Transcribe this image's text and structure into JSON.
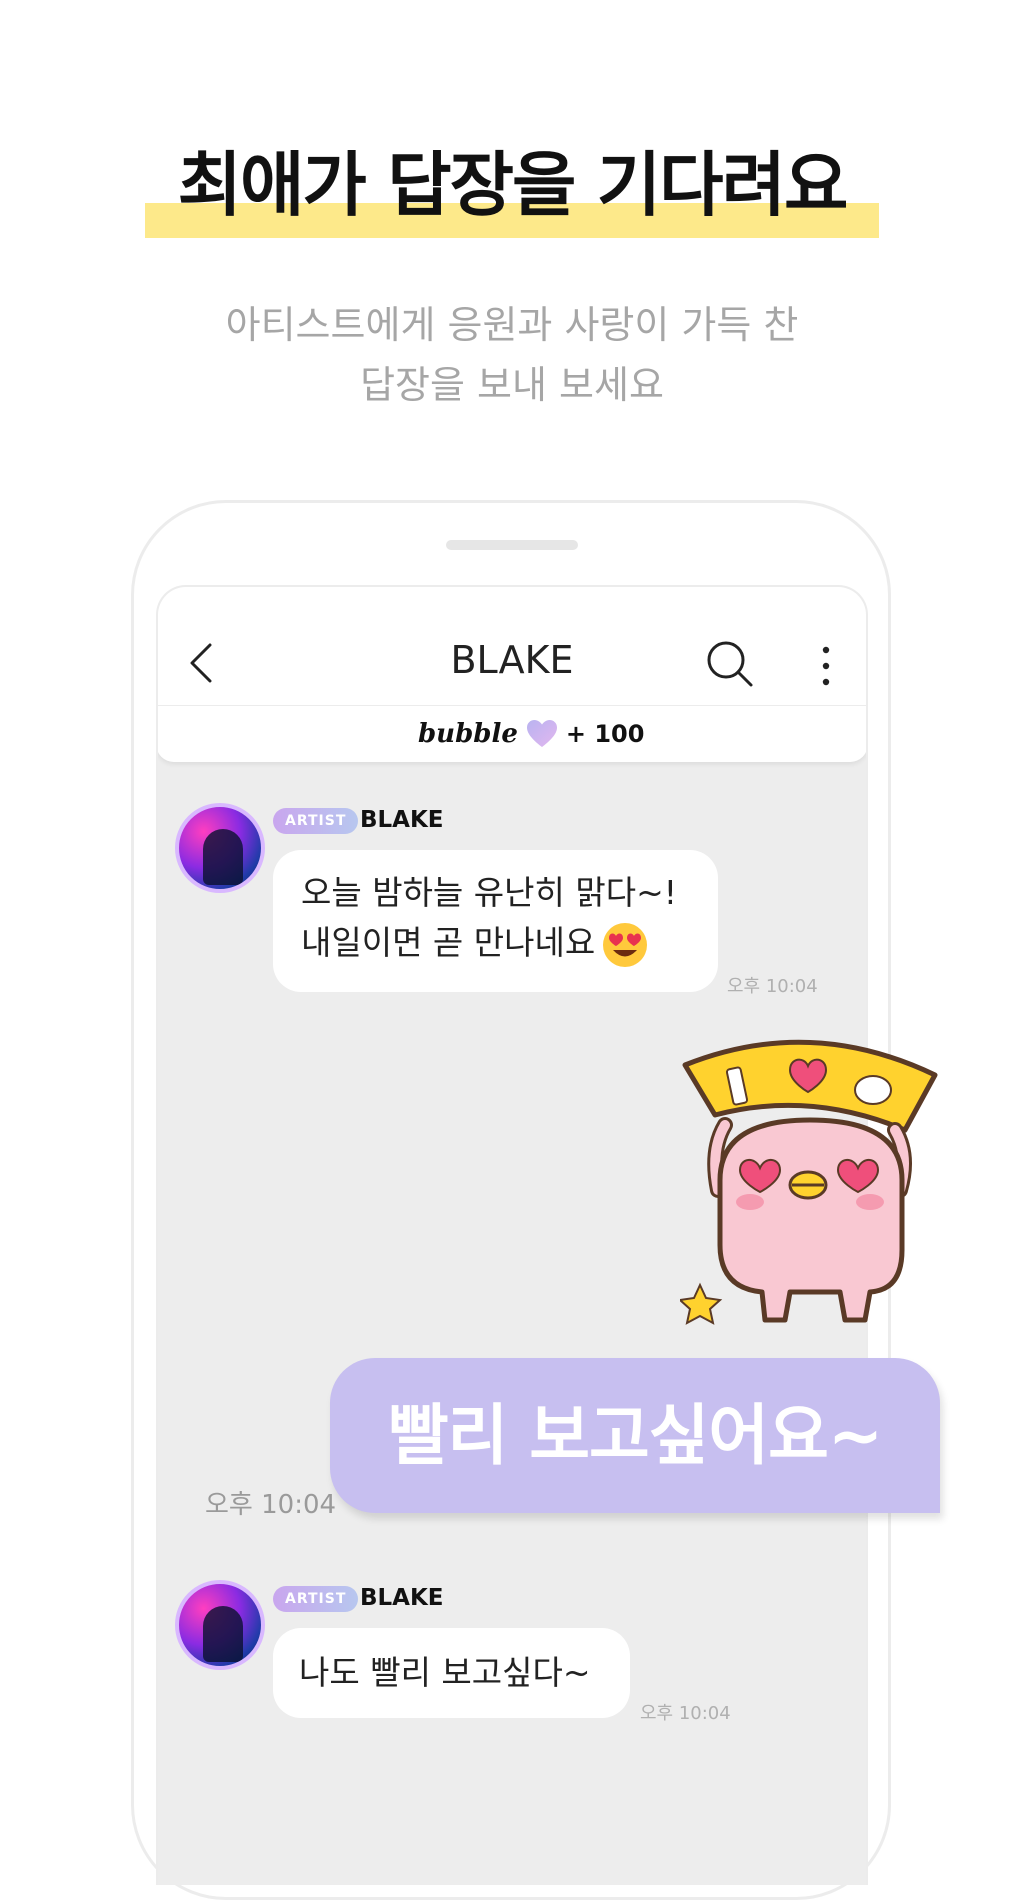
{
  "promo": {
    "headline": "최애가 답장을 기다려요",
    "subtitle_line1": "아티스트에게 응원과 사랑이 가득 찬",
    "subtitle_line2": "답장을 보내 보세요"
  },
  "chat": {
    "title": "BLAKE",
    "brand": "bubble",
    "bonus": "+ 100"
  },
  "messages": [
    {
      "badge": "ARTIST",
      "sender": "BLAKE",
      "line1": "오늘 밤하늘 유난히 맑다~!",
      "line2": "내일이면 곧 만나네요",
      "time": "오후 10:04"
    },
    {
      "text": "빨리 보고싶어요~",
      "time": "오후 10:04"
    },
    {
      "badge": "ARTIST",
      "sender": "BLAKE",
      "line1": "나도 빨리 보고싶다~",
      "time": "오후 10:04"
    }
  ],
  "colors": {
    "highlight": "#fde98a",
    "sent_bubble": "#c7bff0",
    "badge": "#c9a6ee",
    "chat_bg": "#ededed"
  },
  "icons": [
    "back-icon",
    "search-icon",
    "more-icon",
    "heart-icon",
    "smiling-face-heart-eyes-icon"
  ]
}
